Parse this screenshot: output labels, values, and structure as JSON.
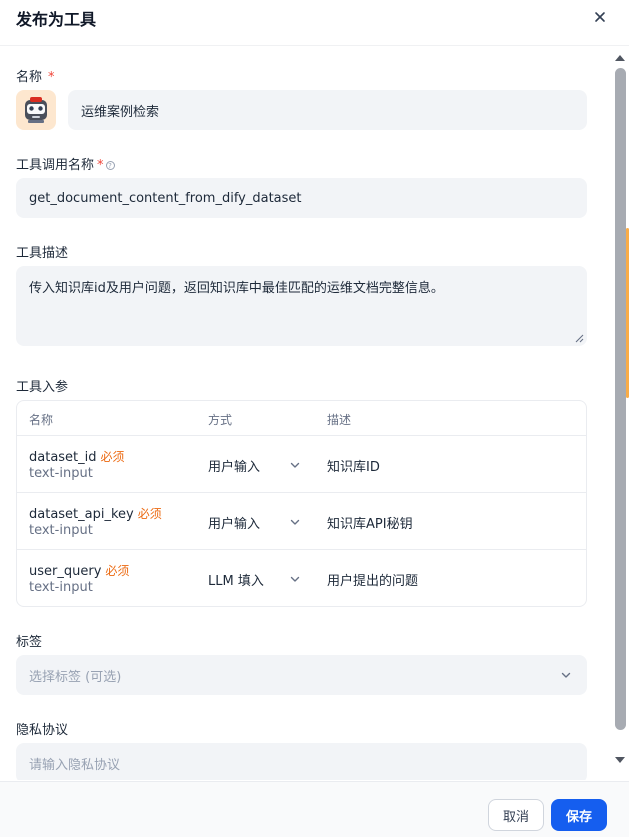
{
  "dialog": {
    "title": "发布为工具"
  },
  "name_section": {
    "label": "名称",
    "required_mark": "*",
    "value": "运维案例检索"
  },
  "tool_call_name": {
    "label": "工具调用名称",
    "required_mark": "*",
    "help_icon": "question-icon",
    "value": "get_document_content_from_dify_dataset"
  },
  "tool_description": {
    "label": "工具描述",
    "value": "传入知识库id及用户问题，返回知识库中最佳匹配的运维文档完整信息。"
  },
  "tool_params": {
    "label": "工具入参",
    "headers": {
      "name": "名称",
      "method": "方式",
      "description": "描述"
    },
    "rows": [
      {
        "name": "dataset_id",
        "required": "必须",
        "type": "text-input",
        "method": "用户输入",
        "description": "知识库ID"
      },
      {
        "name": "dataset_api_key",
        "required": "必须",
        "type": "text-input",
        "method": "用户输入",
        "description": "知识库API秘钥"
      },
      {
        "name": "user_query",
        "required": "必须",
        "type": "text-input",
        "method": "LLM 填入",
        "description": "用户提出的问题"
      }
    ]
  },
  "tags": {
    "label": "标签",
    "placeholder": "选择标签 (可选)"
  },
  "privacy": {
    "label": "隐私协议",
    "placeholder": "请输入隐私协议"
  },
  "footer": {
    "cancel_label": "取消",
    "save_label": "保存"
  },
  "colors": {
    "primary": "#155eef",
    "required": "#f04438",
    "required_tag": "#ec6a12",
    "field_bg": "#f2f4f7"
  }
}
